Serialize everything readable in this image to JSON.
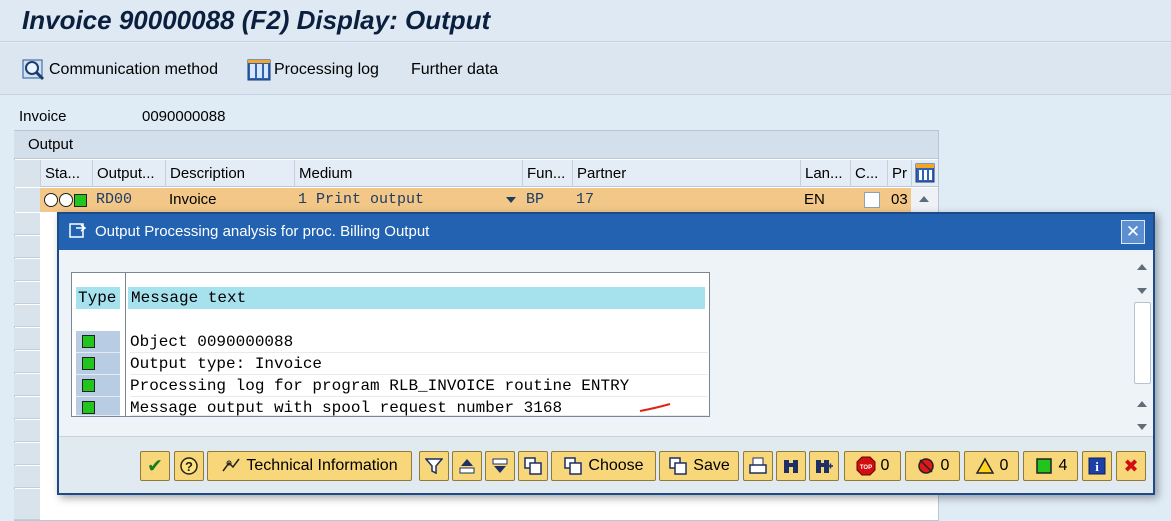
{
  "window": {
    "title": "Invoice 90000088   (F2) Display: Output"
  },
  "toolbar": {
    "communication_method": "Communication method",
    "processing_log": "Processing log",
    "further_data": "Further data"
  },
  "header_fields": {
    "invoice_label": "Invoice",
    "invoice_value": "0090000088"
  },
  "output_table": {
    "section_title": "Output",
    "columns": [
      "Sta...",
      "Output...",
      "Description",
      "Medium",
      "Fun...",
      "Partner",
      "Lan...",
      "C...",
      "Pr"
    ],
    "row": {
      "output_type": "RD00",
      "description": "Invoice",
      "medium": "1 Print output",
      "function": "BP",
      "partner": "17",
      "language": "EN",
      "priority": "03"
    }
  },
  "dialog": {
    "title": "Output Processing analysis for proc. Billing Output",
    "close_label": "✕",
    "columns": {
      "type": "Type",
      "message_text": "Message text"
    },
    "messages": [
      {
        "type": "success",
        "text": "Object 0090000088"
      },
      {
        "type": "success",
        "text": "Output type: Invoice"
      },
      {
        "type": "success",
        "text": "Processing log for program RLB_INVOICE routine ENTRY"
      },
      {
        "type": "success",
        "text": "Message output with spool request number 3168"
      }
    ],
    "footer": {
      "technical_information": "Technical Information",
      "choose": "Choose",
      "save": "Save",
      "stop_count": "0",
      "error_count": "0",
      "warning_count": "0",
      "success_count": "4"
    }
  },
  "colors": {
    "selected_row": "#f2c787",
    "dialog_title": "#2262b0",
    "button": "#f7d77a",
    "status_green": "#22c41e"
  }
}
